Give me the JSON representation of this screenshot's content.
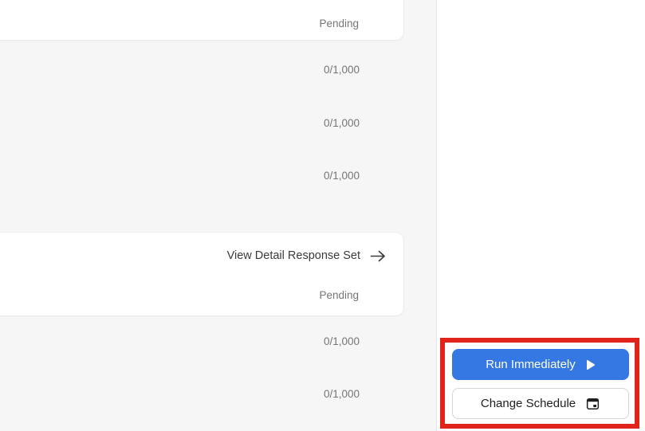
{
  "quota_table": {
    "top_card": {
      "status": "Pending"
    },
    "counts_top": [
      "0/1,000",
      "0/1,000",
      "0/1,000"
    ],
    "detail_card": {
      "link_label": "View Detail Response Set",
      "link_icon": "arrow-right-icon",
      "status": "Pending"
    },
    "counts_bottom": [
      "0/1,000",
      "0/1,000"
    ]
  },
  "action_panel": {
    "run_button": {
      "label": "Run Immediately",
      "icon": "play-icon"
    },
    "schedule_button": {
      "label": "Change Schedule",
      "icon": "calendar-icon"
    },
    "annotation_highlight_color": "#e0241c"
  },
  "colors": {
    "background_gray": "#f6f6f6",
    "card_white": "#ffffff",
    "divider": "#e3e3e3",
    "muted_text": "#757575",
    "dark_text": "#3a3a3a",
    "accent_blue": "#3678e3",
    "annotation_red": "#e0241c"
  }
}
